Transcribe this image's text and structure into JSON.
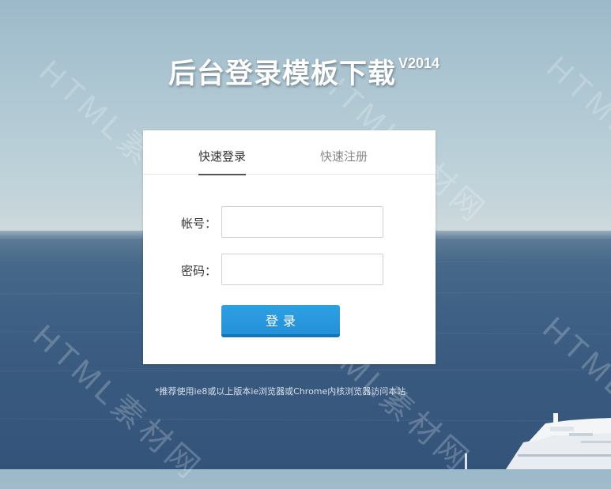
{
  "header": {
    "title": "后台登录模板下载",
    "version": "V2014"
  },
  "login_form": {
    "tabs": [
      {
        "label": "快速登录",
        "active": true
      },
      {
        "label": "快速注册",
        "active": false
      }
    ],
    "account_label": "帐号：",
    "account_value": "",
    "password_label": "密码：",
    "password_value": "",
    "submit_label": "登录"
  },
  "footer": {
    "note": "*推荐使用ie8或以上版本ie浏览器或Chrome内核浏览器访问本站"
  },
  "watermark": {
    "text": "HTML素材网"
  },
  "colors": {
    "button": "#2596dd",
    "button_border": "#1474b6",
    "active_tab_underline": "#555555"
  }
}
